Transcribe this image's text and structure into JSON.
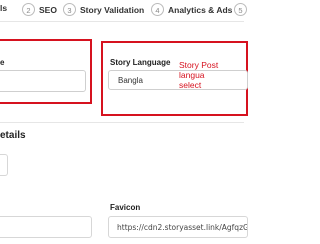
{
  "stepper": {
    "steps": [
      {
        "number": "",
        "label": "ls"
      },
      {
        "number": "2",
        "label": "SEO"
      },
      {
        "number": "3",
        "label": "Story Validation"
      },
      {
        "number": "4",
        "label": "Analytics & Ads"
      },
      {
        "number": "5",
        "label": ""
      }
    ]
  },
  "left_field": {
    "label": "e",
    "value": ""
  },
  "story_language": {
    "label": "Story Language",
    "selected": "Bangla"
  },
  "annotation": {
    "line1": "Story Post langua",
    "line2": "select"
  },
  "details": {
    "heading": "etails"
  },
  "favicon": {
    "label": "Favicon",
    "value": "https://cdn2.storyasset.link/AgfqzGe9"
  },
  "colors": {
    "highlight": "#d6121f",
    "border": "#cfcfcf"
  }
}
